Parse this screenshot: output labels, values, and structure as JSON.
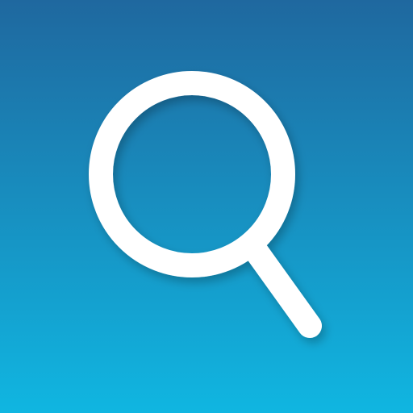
{
  "icon": {
    "name": "search-icon",
    "gradient": {
      "top": "#1F689F",
      "bottom": "#10B6E1"
    },
    "glyph_color": "#FFFFFF"
  }
}
